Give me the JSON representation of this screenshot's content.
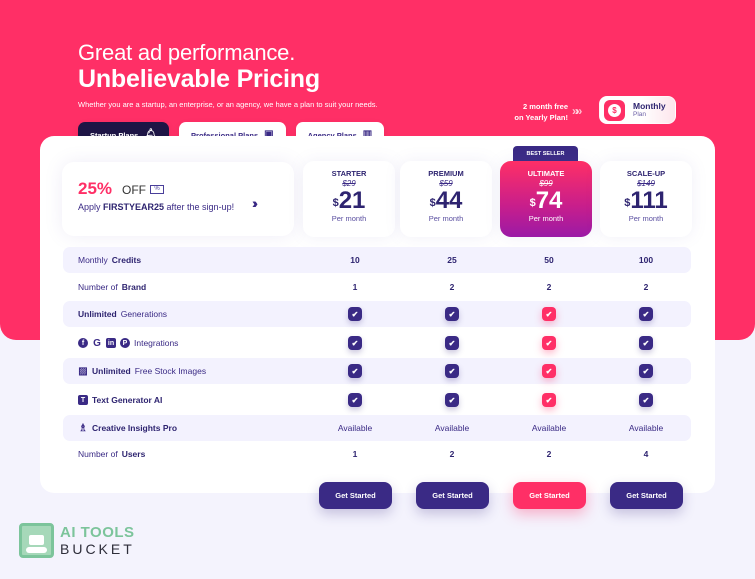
{
  "hero": {
    "headline_line1": "Great ad performance.",
    "headline_line2": "Unbelievable Pricing",
    "subheadline": "Whether you are a startup, an enterprise, or an agency, we have a plan to suit your needs."
  },
  "plan_tabs": [
    {
      "label": "Startup Plans",
      "icon": "rocket-icon",
      "active": true
    },
    {
      "label": "Professional Plans",
      "icon": "briefcase-icon",
      "active": false
    },
    {
      "label": "Agency Plans",
      "icon": "building-icon",
      "active": false
    }
  ],
  "billing": {
    "promo_line1": "2 month free",
    "promo_line2": "on Yearly Plan!",
    "arrows": "»»",
    "toggle_label": "Monthly",
    "toggle_sublabel": "Plan",
    "toggle_icon": "dollar-icon"
  },
  "coupon": {
    "percent": "25%",
    "off": "OFF",
    "tag_icon": "%",
    "apply_prefix": "Apply ",
    "code": "FIRSTYEAR25",
    "apply_suffix": " after the sign-up!",
    "arrows": "›››"
  },
  "best_seller_label": "BEST SELLER",
  "plans": [
    {
      "name": "STARTER",
      "old_price": "$29",
      "currency": "$",
      "price": "21",
      "period": "Per month",
      "cta": "Get Started",
      "featured": false
    },
    {
      "name": "PREMIUM",
      "old_price": "$59",
      "currency": "$",
      "price": "44",
      "period": "Per month",
      "cta": "Get Started",
      "featured": false
    },
    {
      "name": "ULTIMATE",
      "old_price": "$99",
      "currency": "$",
      "price": "74",
      "period": "Per month",
      "cta": "Get Started",
      "featured": true
    },
    {
      "name": "SCALE-UP",
      "old_price": "$149",
      "currency": "$",
      "price": "111",
      "period": "Per month",
      "cta": "Get Started",
      "featured": false
    }
  ],
  "features": [
    {
      "label_pre": "Monthly ",
      "label_bold": "Credits",
      "label_post": "",
      "values": [
        "10",
        "25",
        "50",
        "100"
      ]
    },
    {
      "label_pre": "Number of ",
      "label_bold": "Brand",
      "label_post": "",
      "values": [
        "1",
        "2",
        "2",
        "2"
      ]
    },
    {
      "label_pre": "",
      "label_bold": "Unlimited",
      "label_post": " Generations",
      "values": [
        "✔",
        "✔",
        "✔",
        "✔"
      ]
    },
    {
      "label_pre": "",
      "label_bold": "",
      "label_post": "Integrations",
      "icons": [
        "facebook-icon",
        "google-icon",
        "linkedin-icon",
        "pinterest-icon"
      ],
      "values": [
        "✔",
        "✔",
        "✔",
        "✔"
      ]
    },
    {
      "label_pre": "",
      "label_bold": "Unlimited",
      "label_post": " Free Stock Images",
      "values": [
        "✔",
        "✔",
        "✔",
        "✔"
      ]
    },
    {
      "label_pre": "",
      "label_bold": "Text Generator AI",
      "label_post": "",
      "values": [
        "✔",
        "✔",
        "✔",
        "✔"
      ]
    },
    {
      "label_pre": "",
      "label_bold": "Creative Insights Pro",
      "label_post": "",
      "values": [
        "Available",
        "Available",
        "Available",
        "Available"
      ]
    },
    {
      "label_pre": "Number of ",
      "label_bold": "Users",
      "label_post": "",
      "values": [
        "1",
        "2",
        "2",
        "4"
      ]
    }
  ],
  "brand": {
    "line1": "AI TOOLS",
    "line2": "BUCKET"
  },
  "colors": {
    "accent": "#ff2f66",
    "primary": "#3a2a85",
    "dark": "#1e1545",
    "background": "#f4f3fd"
  }
}
